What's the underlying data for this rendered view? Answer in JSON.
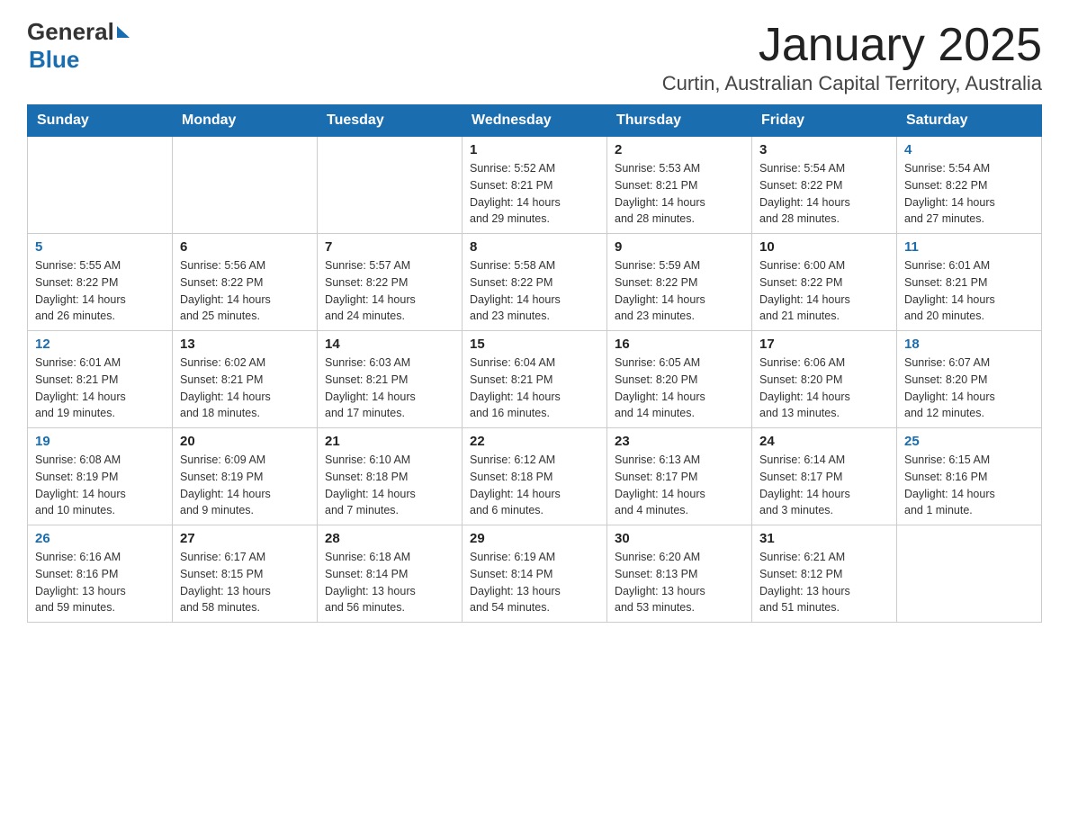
{
  "header": {
    "logo_general": "General",
    "logo_blue": "Blue",
    "title": "January 2025",
    "subtitle": "Curtin, Australian Capital Territory, Australia"
  },
  "days_of_week": [
    "Sunday",
    "Monday",
    "Tuesday",
    "Wednesday",
    "Thursday",
    "Friday",
    "Saturday"
  ],
  "weeks": [
    {
      "days": [
        {
          "number": "",
          "info": ""
        },
        {
          "number": "",
          "info": ""
        },
        {
          "number": "",
          "info": ""
        },
        {
          "number": "1",
          "info": "Sunrise: 5:52 AM\nSunset: 8:21 PM\nDaylight: 14 hours\nand 29 minutes."
        },
        {
          "number": "2",
          "info": "Sunrise: 5:53 AM\nSunset: 8:21 PM\nDaylight: 14 hours\nand 28 minutes."
        },
        {
          "number": "3",
          "info": "Sunrise: 5:54 AM\nSunset: 8:22 PM\nDaylight: 14 hours\nand 28 minutes."
        },
        {
          "number": "4",
          "info": "Sunrise: 5:54 AM\nSunset: 8:22 PM\nDaylight: 14 hours\nand 27 minutes."
        }
      ]
    },
    {
      "days": [
        {
          "number": "5",
          "info": "Sunrise: 5:55 AM\nSunset: 8:22 PM\nDaylight: 14 hours\nand 26 minutes."
        },
        {
          "number": "6",
          "info": "Sunrise: 5:56 AM\nSunset: 8:22 PM\nDaylight: 14 hours\nand 25 minutes."
        },
        {
          "number": "7",
          "info": "Sunrise: 5:57 AM\nSunset: 8:22 PM\nDaylight: 14 hours\nand 24 minutes."
        },
        {
          "number": "8",
          "info": "Sunrise: 5:58 AM\nSunset: 8:22 PM\nDaylight: 14 hours\nand 23 minutes."
        },
        {
          "number": "9",
          "info": "Sunrise: 5:59 AM\nSunset: 8:22 PM\nDaylight: 14 hours\nand 23 minutes."
        },
        {
          "number": "10",
          "info": "Sunrise: 6:00 AM\nSunset: 8:22 PM\nDaylight: 14 hours\nand 21 minutes."
        },
        {
          "number": "11",
          "info": "Sunrise: 6:01 AM\nSunset: 8:21 PM\nDaylight: 14 hours\nand 20 minutes."
        }
      ]
    },
    {
      "days": [
        {
          "number": "12",
          "info": "Sunrise: 6:01 AM\nSunset: 8:21 PM\nDaylight: 14 hours\nand 19 minutes."
        },
        {
          "number": "13",
          "info": "Sunrise: 6:02 AM\nSunset: 8:21 PM\nDaylight: 14 hours\nand 18 minutes."
        },
        {
          "number": "14",
          "info": "Sunrise: 6:03 AM\nSunset: 8:21 PM\nDaylight: 14 hours\nand 17 minutes."
        },
        {
          "number": "15",
          "info": "Sunrise: 6:04 AM\nSunset: 8:21 PM\nDaylight: 14 hours\nand 16 minutes."
        },
        {
          "number": "16",
          "info": "Sunrise: 6:05 AM\nSunset: 8:20 PM\nDaylight: 14 hours\nand 14 minutes."
        },
        {
          "number": "17",
          "info": "Sunrise: 6:06 AM\nSunset: 8:20 PM\nDaylight: 14 hours\nand 13 minutes."
        },
        {
          "number": "18",
          "info": "Sunrise: 6:07 AM\nSunset: 8:20 PM\nDaylight: 14 hours\nand 12 minutes."
        }
      ]
    },
    {
      "days": [
        {
          "number": "19",
          "info": "Sunrise: 6:08 AM\nSunset: 8:19 PM\nDaylight: 14 hours\nand 10 minutes."
        },
        {
          "number": "20",
          "info": "Sunrise: 6:09 AM\nSunset: 8:19 PM\nDaylight: 14 hours\nand 9 minutes."
        },
        {
          "number": "21",
          "info": "Sunrise: 6:10 AM\nSunset: 8:18 PM\nDaylight: 14 hours\nand 7 minutes."
        },
        {
          "number": "22",
          "info": "Sunrise: 6:12 AM\nSunset: 8:18 PM\nDaylight: 14 hours\nand 6 minutes."
        },
        {
          "number": "23",
          "info": "Sunrise: 6:13 AM\nSunset: 8:17 PM\nDaylight: 14 hours\nand 4 minutes."
        },
        {
          "number": "24",
          "info": "Sunrise: 6:14 AM\nSunset: 8:17 PM\nDaylight: 14 hours\nand 3 minutes."
        },
        {
          "number": "25",
          "info": "Sunrise: 6:15 AM\nSunset: 8:16 PM\nDaylight: 14 hours\nand 1 minute."
        }
      ]
    },
    {
      "days": [
        {
          "number": "26",
          "info": "Sunrise: 6:16 AM\nSunset: 8:16 PM\nDaylight: 13 hours\nand 59 minutes."
        },
        {
          "number": "27",
          "info": "Sunrise: 6:17 AM\nSunset: 8:15 PM\nDaylight: 13 hours\nand 58 minutes."
        },
        {
          "number": "28",
          "info": "Sunrise: 6:18 AM\nSunset: 8:14 PM\nDaylight: 13 hours\nand 56 minutes."
        },
        {
          "number": "29",
          "info": "Sunrise: 6:19 AM\nSunset: 8:14 PM\nDaylight: 13 hours\nand 54 minutes."
        },
        {
          "number": "30",
          "info": "Sunrise: 6:20 AM\nSunset: 8:13 PM\nDaylight: 13 hours\nand 53 minutes."
        },
        {
          "number": "31",
          "info": "Sunrise: 6:21 AM\nSunset: 8:12 PM\nDaylight: 13 hours\nand 51 minutes."
        },
        {
          "number": "",
          "info": ""
        }
      ]
    }
  ]
}
